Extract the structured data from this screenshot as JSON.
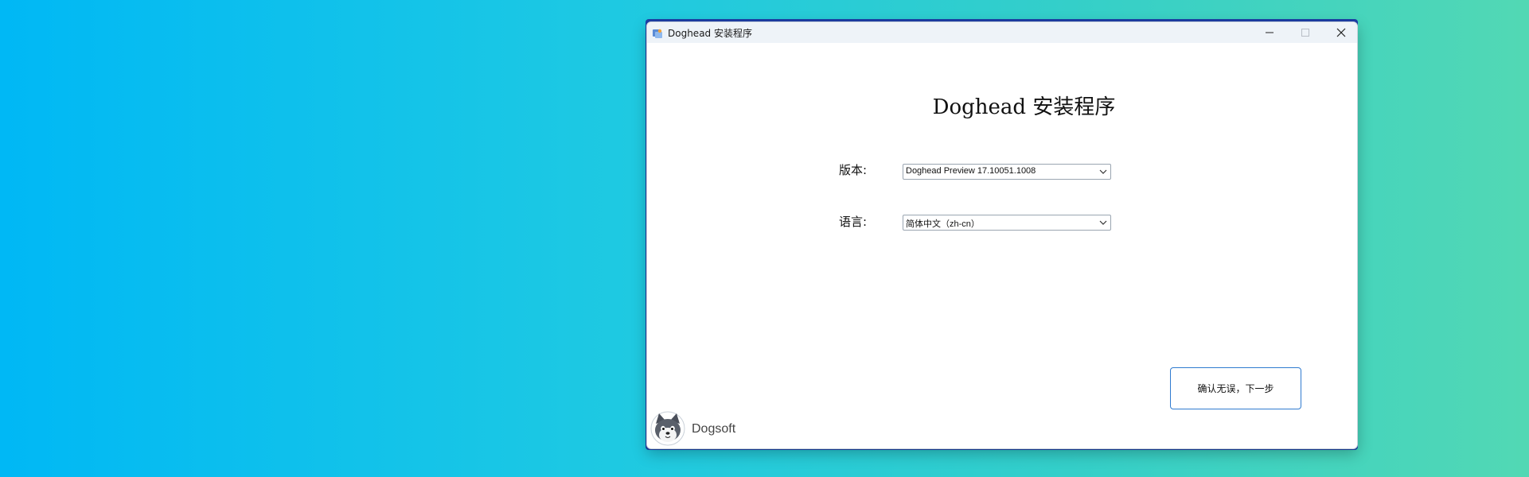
{
  "window": {
    "title": "Doghead 安装程序",
    "controls": {
      "minimize_icon": "minimize-icon",
      "maximize_icon": "maximize-icon",
      "close_icon": "close-icon"
    }
  },
  "main": {
    "heading": "Doghead 安装程序",
    "version": {
      "label": "版本:",
      "selected": "Doghead Preview 17.10051.1008"
    },
    "language": {
      "label": "语言:",
      "selected": "简体中文（zh-cn）"
    },
    "next_button_label": "确认无误，下一步"
  },
  "footer": {
    "brand": "Dogsoft",
    "logo_icon": "dog-logo-icon"
  },
  "colors": {
    "accent": "#2f7bd0",
    "desktop_start": "#00b8f5",
    "desktop_end": "#52d8b4"
  }
}
